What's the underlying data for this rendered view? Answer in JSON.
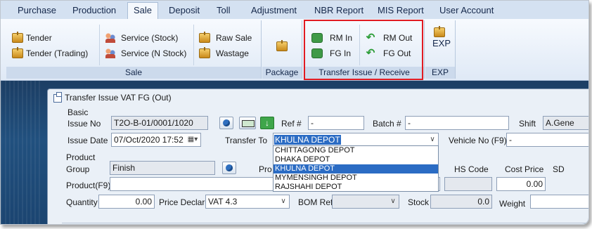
{
  "tabs": [
    "Purchase",
    "Production",
    "Sale",
    "Deposit",
    "Toll",
    "Adjustment",
    "NBR Report",
    "MIS Report",
    "User Account"
  ],
  "active_tab": "Sale",
  "ribbon": {
    "sale": {
      "caption": "Sale",
      "tender": "Tender",
      "tender_trading": "Tender (Trading)",
      "service_stock": "Service (Stock)",
      "service_nstock": "Service (N Stock)",
      "raw_sale": "Raw Sale",
      "wastage": "Wastage"
    },
    "package": {
      "caption": "Package"
    },
    "transfer": {
      "caption": "Transfer  Issue / Receive",
      "rm_in": "RM In",
      "fg_in": "FG In",
      "rm_out": "RM Out",
      "fg_out": "FG Out"
    },
    "exp": {
      "caption": "EXP",
      "label": "EXP"
    }
  },
  "dialog": {
    "title": "Transfer Issue VAT FG (Out)",
    "basic_label": "Basic",
    "issue_no_label": "Issue No",
    "issue_no": "T2O-B-01/0001/1020",
    "ref_label": "Ref #",
    "ref_value": "-",
    "batch_label": "Batch #",
    "batch_value": "-",
    "shift_label": "Shift",
    "shift_value": "A.Gene",
    "issue_date_label": "Issue Date",
    "issue_date": "07/Oct/2020 17:52",
    "transfer_to_label": "Transfer To",
    "transfer_to": "KHULNA DEPOT",
    "vehicle_label": "Vehicle No (F9)",
    "vehicle_value": "-",
    "depots": [
      "CHITTAGONG DEPOT",
      "DHAKA DEPOT",
      "KHULNA DEPOT",
      "MYMENSINGH DEPOT",
      "RAJSHAHI DEPOT"
    ],
    "selected_depot": "KHULNA DEPOT",
    "product_label": "Product",
    "group_label": "Group",
    "group_value": "Finish",
    "pro_label": "Pro",
    "hs_code_label": "HS Code",
    "cost_price_label": "Cost Price",
    "sd_label": "SD",
    "product_f9_label": "Product(F9)",
    "cost_price": "0.00",
    "quantity_label": "Quantity",
    "quantity": "0.00",
    "price_declare_label": "Price Declare",
    "price_declare": "VAT 4.3",
    "bom_label": "BOM Ref.",
    "stock_label": "Stock",
    "stock": "0.0",
    "weight_label": "Weight"
  }
}
